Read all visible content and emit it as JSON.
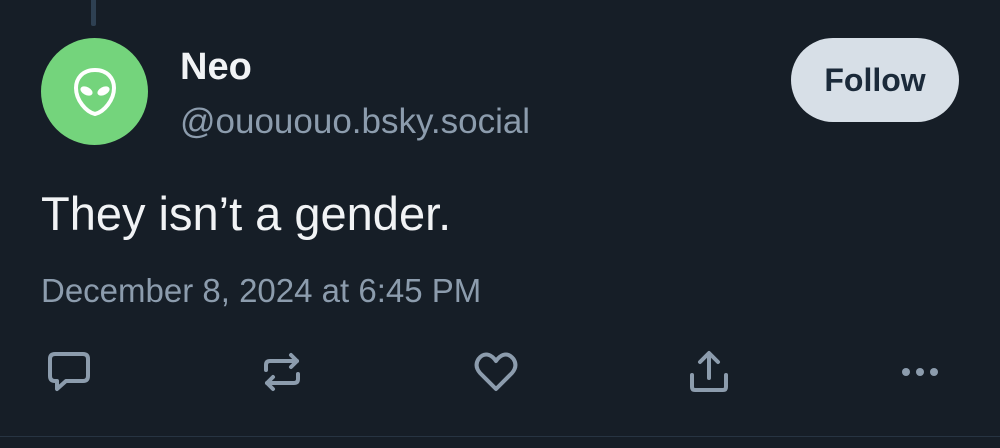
{
  "post": {
    "author": {
      "display_name": "Neo",
      "handle": "@ouououo.bsky.social",
      "avatar_icon": "alien-icon",
      "avatar_color": "#74d47c"
    },
    "follow_label": "Follow",
    "text": "They isn’t a gender.",
    "timestamp": "December 8, 2024 at 6:45 PM"
  },
  "actions": [
    {
      "name": "reply",
      "icon": "speech-bubble-icon"
    },
    {
      "name": "repost",
      "icon": "repost-arrows-icon"
    },
    {
      "name": "like",
      "icon": "heart-icon"
    },
    {
      "name": "share",
      "icon": "share-upload-icon"
    },
    {
      "name": "more",
      "icon": "ellipsis-icon"
    }
  ],
  "colors": {
    "background": "#161e27",
    "primary_text": "#f1f3f5",
    "secondary_text": "#8c9cad",
    "follow_button_bg": "#d7dfe7",
    "follow_button_text": "#1b2a3a",
    "icon": "#8c9cad"
  }
}
